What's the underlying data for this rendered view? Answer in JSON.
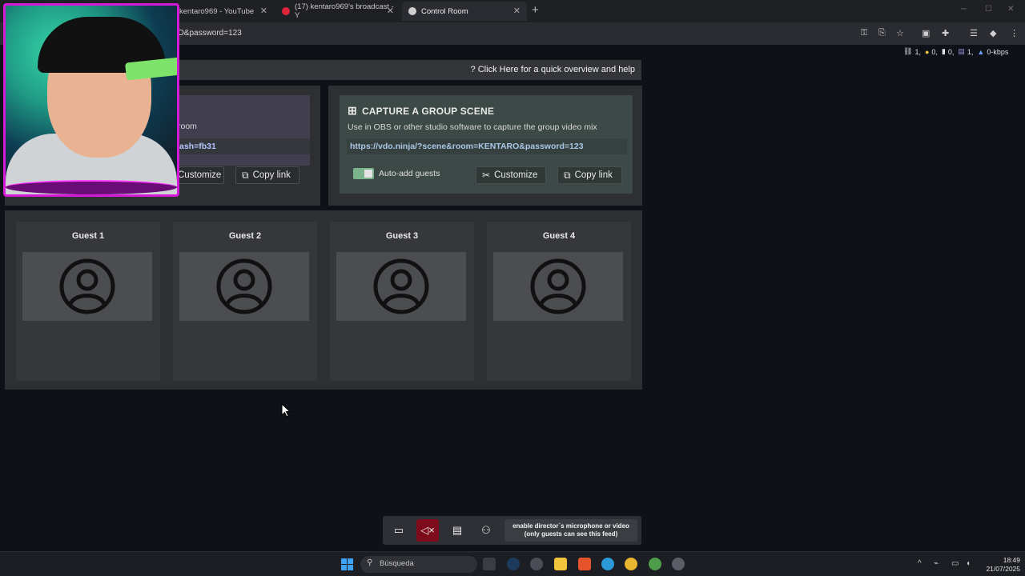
{
  "browser": {
    "tabs": [
      {
        "label": "kentaro969 - YouTube",
        "active": false
      },
      {
        "label": "(17) kentaro969's broadcast - Y",
        "active": false
      },
      {
        "label": "Control Room",
        "active": true
      }
    ],
    "new_tab": "+",
    "url": "O&password=123",
    "close_glyph": "✕"
  },
  "stats": {
    "connections": "1,",
    "mic": "0,",
    "video": "0,",
    "screens": "1,",
    "bitrate": "0-kbps"
  },
  "help": {
    "label": "Click Here for a quick overview and help"
  },
  "invite_panel": {
    "desc_fragment": "room",
    "link_fragment": "ash=fb31",
    "customize_label": "Customize",
    "copy_label": "Copy link"
  },
  "scene_panel": {
    "title": "CAPTURE A GROUP SCENE",
    "description": "Use in OBS or other studio software to capture the group video mix",
    "link": "https://vdo.ninja/?scene&room=KENTARO&password=123",
    "toggle_label": "Auto-add guests",
    "toggle_on": true,
    "customize_label": "Customize",
    "copy_label": "Copy link"
  },
  "guests": [
    {
      "name": "Guest 1"
    },
    {
      "name": "Guest 2"
    },
    {
      "name": "Guest 3"
    },
    {
      "name": "Guest 4"
    }
  ],
  "director_bar": {
    "mic_hint_line1": "enable director`s microphone or video",
    "mic_hint_line2": "(only guests can see this feed)"
  },
  "taskbar": {
    "search_placeholder": "Búsqueda",
    "time": "18:49",
    "date": "21/07/2025"
  },
  "colors": {
    "accent_toggle": "#7bb38c",
    "muted_button": "#7d0b1a",
    "link_text": "#a9c8e6",
    "webcam_border": "#d41ad6"
  }
}
